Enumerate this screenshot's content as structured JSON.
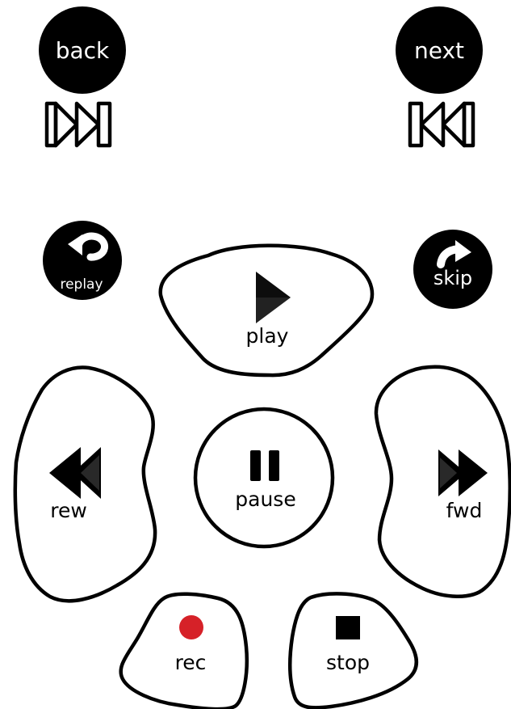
{
  "remote": {
    "colors": {
      "button_fill": "#000000",
      "label_on_dark": "#ffffff",
      "outline": "#000000",
      "pad_fill": "#ffffff",
      "glyph": "#222222",
      "record": "#d62128"
    },
    "buttons": {
      "back": {
        "label": "back",
        "icon": "skip-previous-icon"
      },
      "next": {
        "label": "next",
        "icon": "skip-next-icon"
      },
      "replay": {
        "label": "replay",
        "icon": "replay-arrow-icon"
      },
      "skip": {
        "label": "skip",
        "icon": "skip-arrow-icon"
      },
      "play": {
        "label": "play",
        "icon": "play-icon"
      },
      "rew": {
        "label": "rew",
        "icon": "rewind-icon"
      },
      "pause": {
        "label": "pause",
        "icon": "pause-icon"
      },
      "fwd": {
        "label": "fwd",
        "icon": "fast-forward-icon"
      },
      "rec": {
        "label": "rec",
        "icon": "record-icon"
      },
      "stop": {
        "label": "stop",
        "icon": "stop-icon"
      }
    }
  }
}
